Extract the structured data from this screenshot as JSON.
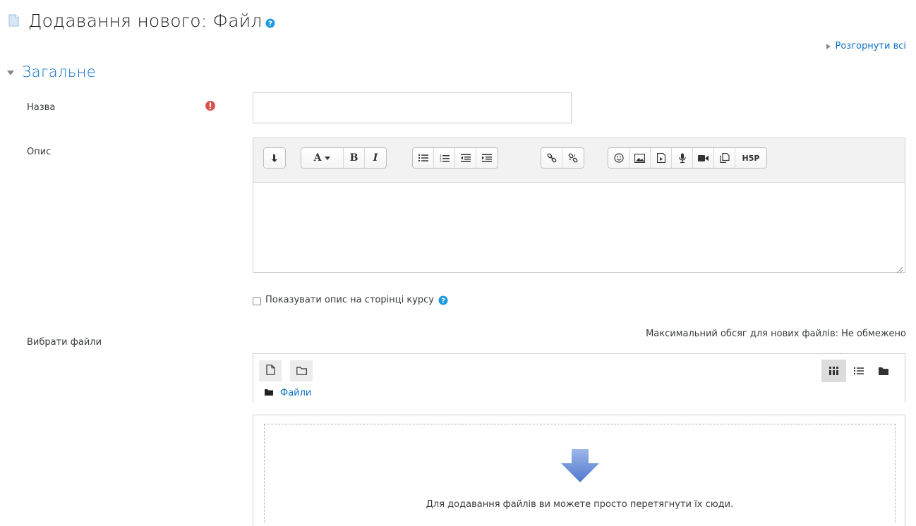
{
  "page": {
    "title": "Додавання нового: Файл"
  },
  "links": {
    "expand_all": "Розгорнути всі"
  },
  "section": {
    "title": "Загальне"
  },
  "fields": {
    "name_label": "Назва",
    "name_value": "",
    "description_label": "Опис",
    "show_description_label": "Показувати опис на сторінці курсу",
    "show_description_checked": false,
    "select_files_label": "Вибрати файли"
  },
  "editor": {
    "toolbar_groups": [
      [
        "collapse-icon"
      ],
      [
        "font-style-icon",
        "bold-icon",
        "italic-icon"
      ],
      [
        "unordered-list-icon",
        "ordered-list-icon",
        "outdent-icon",
        "indent-icon"
      ],
      [
        "link-icon",
        "unlink-icon"
      ],
      [
        "emoticon-icon",
        "image-icon",
        "media-icon",
        "record-audio-icon",
        "record-video-icon",
        "manage-files-icon",
        "h5p-icon"
      ]
    ],
    "bold_glyph": "B",
    "italic_glyph": "I",
    "font_glyph": "A",
    "h5p_label": "H5P"
  },
  "filemanager": {
    "max_size_text": "Максимальний обсяг для нових файлів: Не обмежено",
    "path_label": "Файли",
    "drop_text": "Для додавання файлів ви можете просто перетягнути їх сюди.",
    "active_view": "icons"
  },
  "colors": {
    "link": "#0f6fc5",
    "required": "#d9534f",
    "help": "#1e9be0",
    "drop_arrow": "#6b8fd6"
  }
}
